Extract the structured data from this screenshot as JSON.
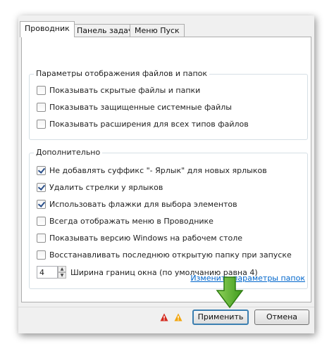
{
  "tabs": [
    {
      "label": "Проводник",
      "active": true
    },
    {
      "label": "Панель задач",
      "active": false
    },
    {
      "label": "Меню Пуск",
      "active": false
    }
  ],
  "group_files": {
    "title": "Параметры отображения файлов и папок",
    "options": [
      {
        "label": "Показывать скрытые файлы и папки",
        "checked": false
      },
      {
        "label": "Показывать защищенные системные файлы",
        "checked": false
      },
      {
        "label": "Показывать расширения для всех типов файлов",
        "checked": false
      }
    ]
  },
  "group_extra": {
    "title": "Дополнительно",
    "options": [
      {
        "label": "Не добавлять суффикс \"- Ярлык\" для новых ярлыков",
        "checked": true
      },
      {
        "label": "Удалить стрелки у ярлыков",
        "checked": true
      },
      {
        "label": "Использовать флажки для выбора элементов",
        "checked": true
      },
      {
        "label": "Всегда отображать меню в Проводнике",
        "checked": false
      },
      {
        "label": "Показывать версию Windows на рабочем столе",
        "checked": false
      },
      {
        "label": "Восстанавливать последнюю открытую папку при запуске",
        "checked": false
      }
    ],
    "border_width": {
      "value": "4",
      "label": "Ширина границ окна (по умолчанию равна 4)"
    }
  },
  "folder_options_link": "Изменить параметры папок",
  "buttons": {
    "apply": "Применить",
    "cancel": "Отмена"
  },
  "colors": {
    "warning_red": "#d42a1e",
    "warning_orange": "#f2a50c",
    "arrow_green": "#5cb82e",
    "link": "#0066cc",
    "default_border": "#3c7fb1"
  },
  "icons": [
    "warning-red-icon",
    "warning-orange-icon",
    "green-down-arrow-icon"
  ]
}
